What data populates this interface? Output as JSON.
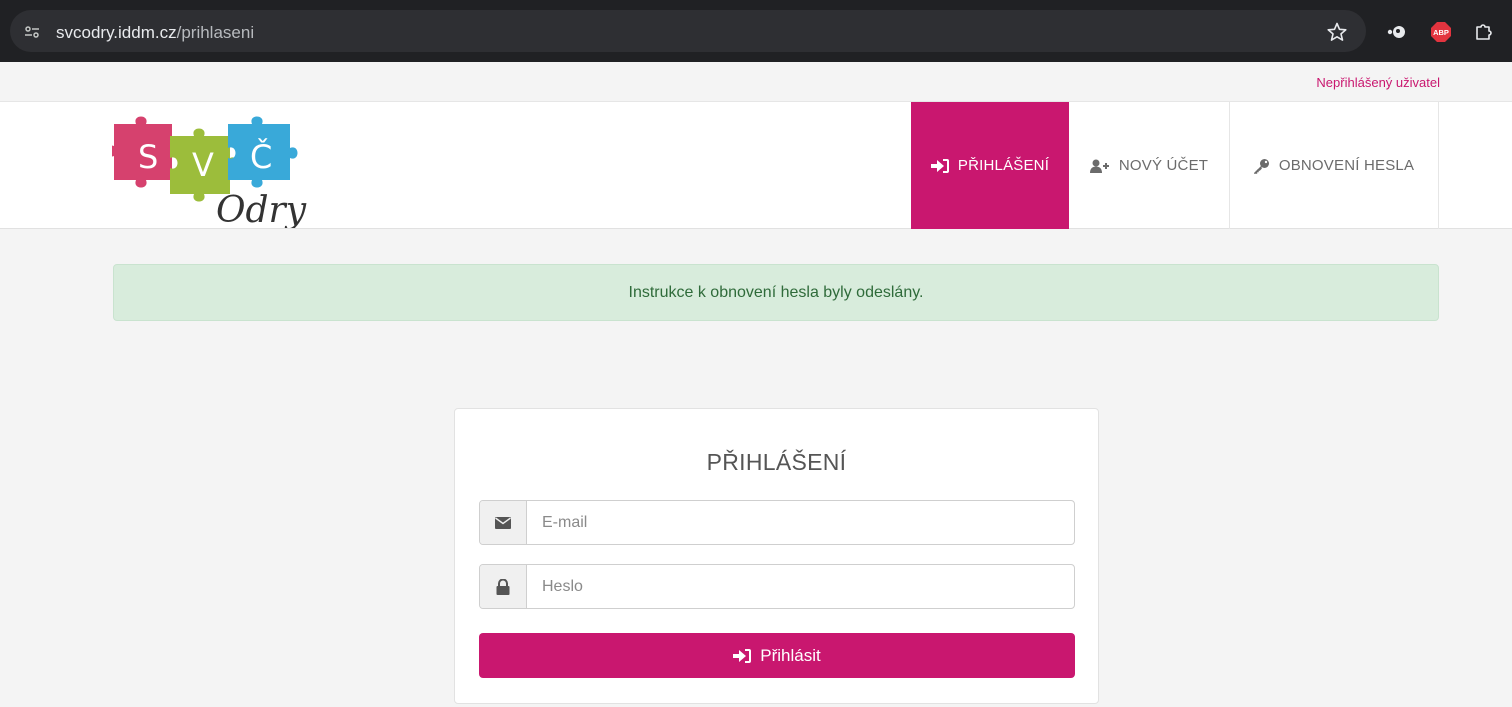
{
  "browser": {
    "url_host": "svcodry.iddm.cz",
    "url_path": "/prihlaseni",
    "icons": [
      "site-info-icon",
      "star-icon",
      "extension-icon",
      "adblock-icon",
      "puzzle-icon"
    ],
    "abp_label": "ABP"
  },
  "user_bar": {
    "status": "Nepřihlášený uživatel"
  },
  "header": {
    "logo": {
      "letters": [
        "S",
        "V",
        "Č"
      ],
      "script": "Odry",
      "colors": [
        "#d6416e",
        "#9cbd3b",
        "#39a9d9"
      ]
    },
    "nav": [
      {
        "label": "PŘIHLÁŠENÍ",
        "icon": "sign-in-icon",
        "active": true
      },
      {
        "label": "NOVÝ ÚČET",
        "icon": "user-plus-icon",
        "active": false
      },
      {
        "label": "OBNOVENÍ HESLA",
        "icon": "key-icon",
        "active": false
      }
    ]
  },
  "alert": {
    "message": "Instrukce k obnovení hesla byly odeslány."
  },
  "login": {
    "title": "PŘIHLÁŠENÍ",
    "email_placeholder": "E-mail",
    "email_value": "",
    "password_placeholder": "Heslo",
    "password_value": "",
    "submit_label": "Přihlásit"
  },
  "colors": {
    "accent": "#c9176f",
    "alert_bg": "#d8ecdc",
    "alert_text": "#2f6b3a",
    "browser_bg": "#202124"
  }
}
